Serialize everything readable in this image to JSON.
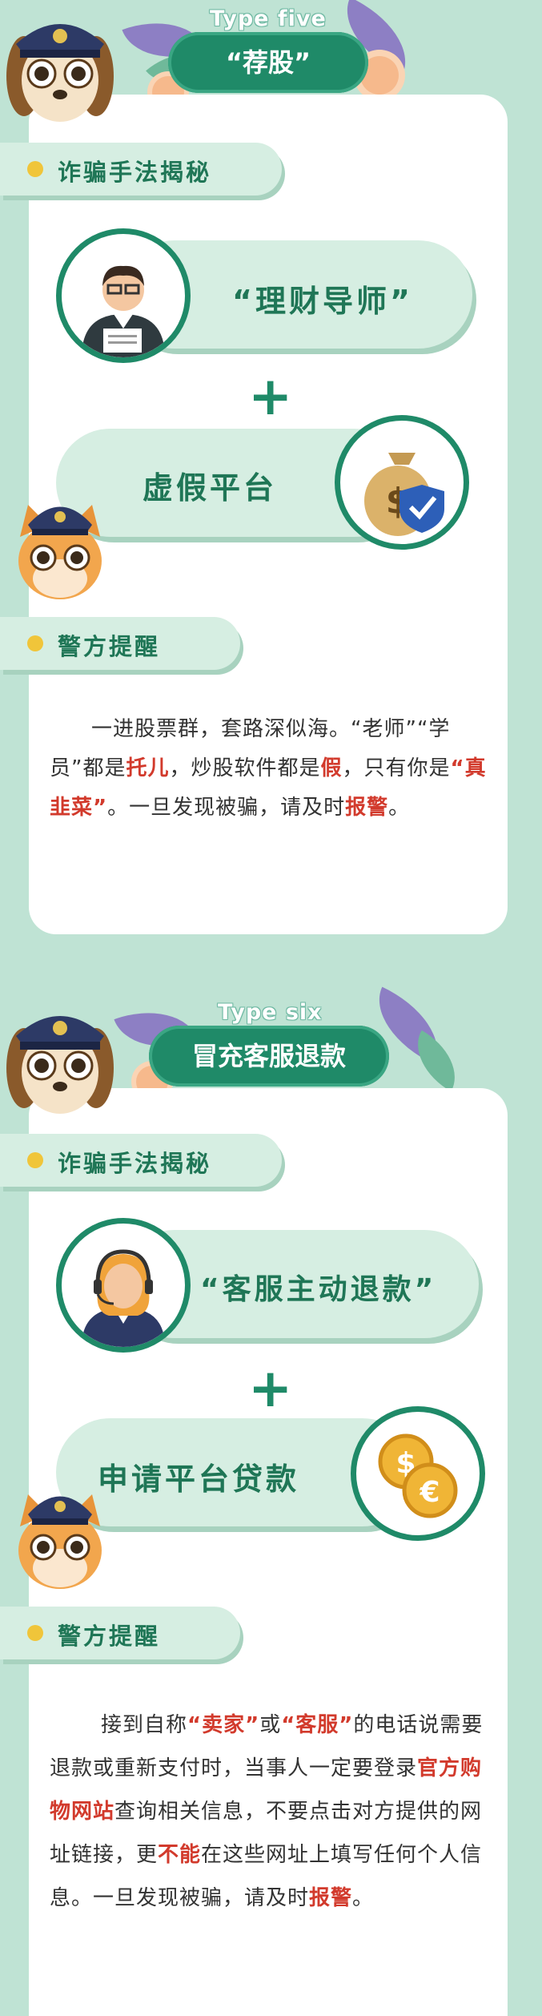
{
  "colors": {
    "background": "#bfe3d4",
    "accent": "#1f8a68",
    "pill": "#d6eee2",
    "highlight": "#d23a2c",
    "dot": "#f0c53a"
  },
  "sections": [
    {
      "type_label": "Type five",
      "title": "“荐股”",
      "reveal_label": "诈骗手法揭秘",
      "item1": "“理财导师”",
      "plus": "+",
      "item2": "虚假平台",
      "warning_label": "警方提醒",
      "para": {
        "s1": "一进股票群，套路深似海。“老师”“学员”都是",
        "h1": "托儿",
        "s2": "，炒股软件都是",
        "h2": "假",
        "s3": "，只有你是",
        "h3": "“真韭菜”",
        "s4": "。一旦发现被骗，请及时",
        "h4": "报警",
        "s5": "。"
      }
    },
    {
      "type_label": "Type six",
      "title": "冒充客服退款",
      "reveal_label": "诈骗手法揭秘",
      "item1": "“客服主动退款”",
      "plus": "+",
      "item2": "申请平台贷款",
      "warning_label": "警方提醒",
      "para": {
        "s1": "接到自称",
        "h1": "“卖家”",
        "s2": "或",
        "h2": "“客服”",
        "s3": "的电话说需要退款或重新支付时，当事人一定要登录",
        "h3": "官方购物网站",
        "s4": "查询相关信息，不要点击对方提供的网址链接，更",
        "h4": "不能",
        "s5": "在这些网址上填写任何个人信息。一旦发现被骗，请及时",
        "h5": "报警",
        "s6": "。"
      }
    }
  ]
}
